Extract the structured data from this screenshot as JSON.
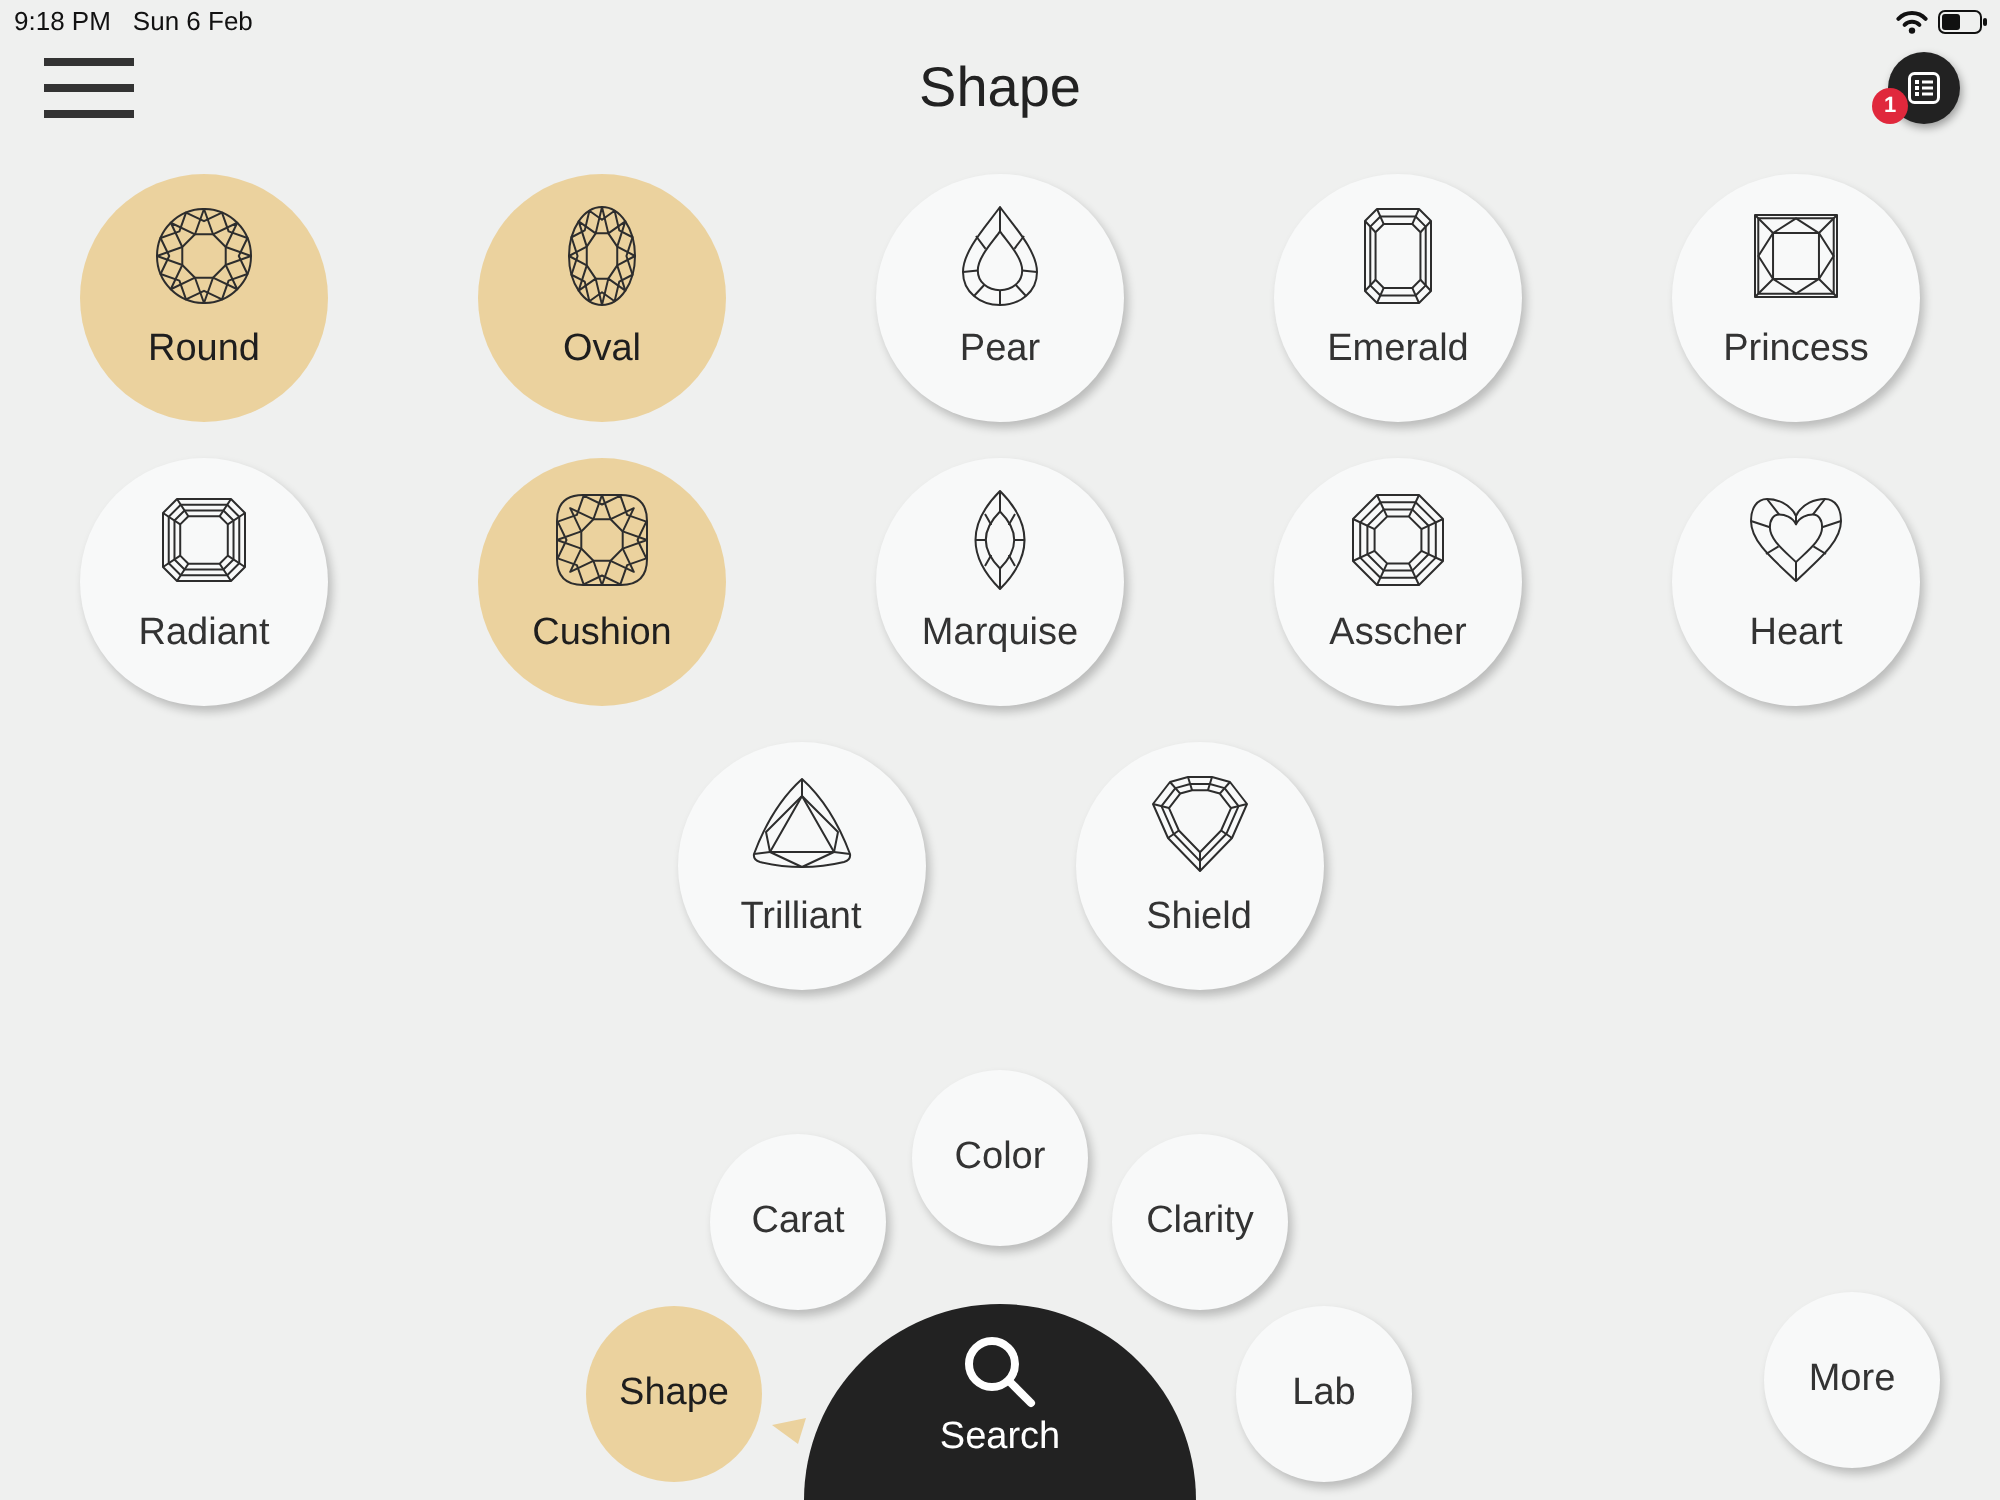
{
  "status_bar": {
    "time": "9:18 PM",
    "date": "Sun 6 Feb"
  },
  "header": {
    "title": "Shape",
    "badge": "1"
  },
  "shapes": [
    {
      "label": "Round",
      "kind": "round",
      "selected": true
    },
    {
      "label": "Oval",
      "kind": "oval",
      "selected": true
    },
    {
      "label": "Pear",
      "kind": "pear",
      "selected": false
    },
    {
      "label": "Emerald",
      "kind": "emerald",
      "selected": false
    },
    {
      "label": "Princess",
      "kind": "princess",
      "selected": false
    },
    {
      "label": "Radiant",
      "kind": "radiant",
      "selected": false
    },
    {
      "label": "Cushion",
      "kind": "cushion",
      "selected": true
    },
    {
      "label": "Marquise",
      "kind": "marquise",
      "selected": false
    },
    {
      "label": "Asscher",
      "kind": "asscher",
      "selected": false
    },
    {
      "label": "Heart",
      "kind": "heart",
      "selected": false
    },
    {
      "label": "Trilliant",
      "kind": "trilliant",
      "selected": false
    },
    {
      "label": "Shield",
      "kind": "shield",
      "selected": false
    }
  ],
  "filter_menu": {
    "items": [
      {
        "label": "Shape",
        "selected": true
      },
      {
        "label": "Carat",
        "selected": false
      },
      {
        "label": "Color",
        "selected": false
      },
      {
        "label": "Clarity",
        "selected": false
      },
      {
        "label": "Lab",
        "selected": false
      }
    ],
    "search": {
      "label": "Search"
    },
    "more": {
      "label": "More"
    }
  }
}
